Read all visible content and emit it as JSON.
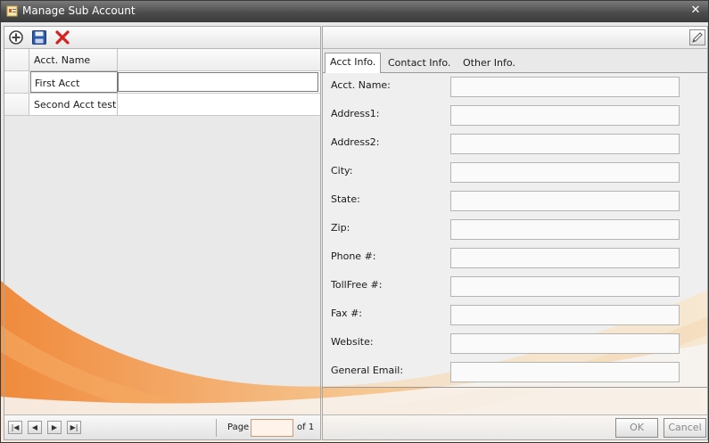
{
  "window": {
    "title": "Manage Sub Account"
  },
  "colors": {
    "accent": "#f08a3c",
    "accent_light": "#f6c690",
    "title_bar": "#4c4c4c"
  },
  "toolbar": {
    "icons": [
      "add-icon",
      "save-icon",
      "delete-icon"
    ]
  },
  "grid": {
    "columns": [
      "Acct. Name"
    ],
    "rows": [
      {
        "name": "First Acct",
        "selected": true
      },
      {
        "name": "Second Acct test",
        "selected": false
      }
    ]
  },
  "pager": {
    "page_label": "Page",
    "page_value": "",
    "of_label": "of 1"
  },
  "tabs": [
    {
      "label": "Acct Info.",
      "active": true
    },
    {
      "label": "Contact Info.",
      "active": false
    },
    {
      "label": "Other Info.",
      "active": false
    }
  ],
  "form": {
    "fields": [
      {
        "label": "Acct. Name:",
        "value": ""
      },
      {
        "label": "Address1:",
        "value": ""
      },
      {
        "label": "Address2:",
        "value": ""
      },
      {
        "label": "City:",
        "value": ""
      },
      {
        "label": "State:",
        "value": ""
      },
      {
        "label": "Zip:",
        "value": ""
      },
      {
        "label": "Phone #:",
        "value": ""
      },
      {
        "label": "TollFree #:",
        "value": ""
      },
      {
        "label": "Fax #:",
        "value": ""
      },
      {
        "label": "Website:",
        "value": ""
      },
      {
        "label": "General Email:",
        "value": ""
      }
    ]
  },
  "buttons": {
    "ok": "OK",
    "cancel": "Cancel"
  }
}
